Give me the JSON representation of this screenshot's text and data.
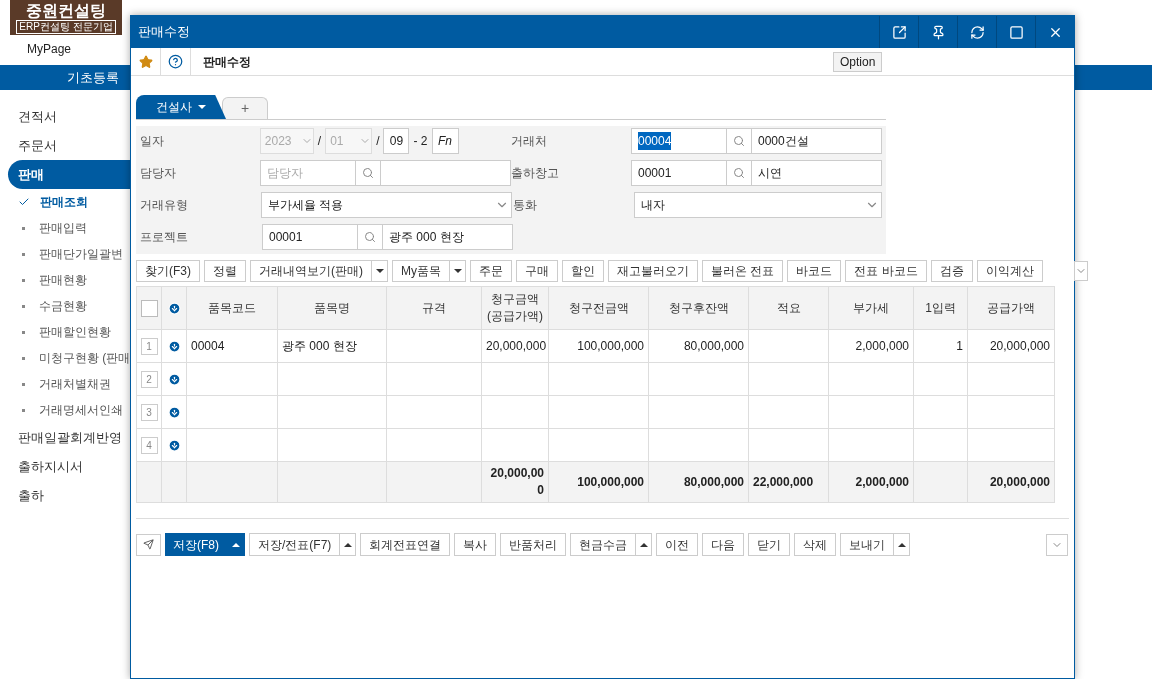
{
  "app": {
    "logo_title": "중원컨설팅",
    "logo_subtitle": "ERP컨설팅 전문기업",
    "mypage": "MyPage",
    "menu_bar": "기초등록"
  },
  "sidebar": [
    {
      "label": "견적서",
      "selected": false
    },
    {
      "label": "주문서",
      "selected": false
    },
    {
      "label": "판매",
      "selected": true,
      "children": [
        {
          "label": "판매조회",
          "selected": true
        },
        {
          "label": "판매입력",
          "selected": false
        },
        {
          "label": "판매단가일괄변",
          "selected": false
        },
        {
          "label": "판매현황",
          "selected": false
        },
        {
          "label": "수금현황",
          "selected": false
        },
        {
          "label": "판매할인현황",
          "selected": false
        },
        {
          "label": "미청구현황 (판매",
          "selected": false
        },
        {
          "label": "거래처별채권",
          "selected": false
        },
        {
          "label": "거래명세서인쇄",
          "selected": false
        }
      ]
    },
    {
      "label": "판매일괄회계반영",
      "selected": false
    },
    {
      "label": "출하지시서",
      "selected": false
    },
    {
      "label": "출하",
      "selected": false
    }
  ],
  "window": {
    "title": "판매수정"
  },
  "header": {
    "favorite": true,
    "title": "판매수정",
    "option": "Option"
  },
  "tabs": [
    {
      "label": "건설사",
      "selected": true
    },
    {
      "label": "+",
      "selected": false
    }
  ],
  "form": {
    "date": {
      "label": "일자",
      "year": "2023",
      "month": "01",
      "day": "09",
      "sep1": "/",
      "sep2": "/",
      "suffix": "- 2",
      "fn": "Fn"
    },
    "customer": {
      "label": "거래처",
      "code": "00004",
      "name": "0000건설",
      "code_selected": true
    },
    "manager": {
      "label": "담당자",
      "placeholder": "담당자"
    },
    "warehouse": {
      "label": "출하창고",
      "code": "00001",
      "name": "시연"
    },
    "trade_type": {
      "label": "거래유형",
      "value": "부가세율 적용"
    },
    "currency": {
      "label": "통화",
      "value": "내자"
    },
    "project": {
      "label": "프로젝트",
      "code": "00001",
      "name": "광주 000 현장"
    }
  },
  "actions": [
    {
      "label": "찾기(F3)",
      "dropdown": false
    },
    {
      "label": "정렬",
      "dropdown": false
    },
    {
      "label": "거래내역보기(판매)",
      "dropdown": true
    },
    {
      "label": "My품목",
      "dropdown": true
    },
    {
      "label": "주문",
      "dropdown": false
    },
    {
      "label": "구매",
      "dropdown": false
    },
    {
      "label": "할인",
      "dropdown": false
    },
    {
      "label": "재고불러오기",
      "dropdown": false
    },
    {
      "label": "불러온 전표",
      "dropdown": false
    },
    {
      "label": "바코드",
      "dropdown": false
    },
    {
      "label": "전표 바코드",
      "dropdown": false
    },
    {
      "label": "검증",
      "dropdown": false
    },
    {
      "label": "이익계산",
      "dropdown": false
    }
  ],
  "table": {
    "select_all_checked": false,
    "columns": [
      {
        "label": "품목코드"
      },
      {
        "label": "품목명"
      },
      {
        "label": "규격"
      },
      {
        "label": "청구금액",
        "sub": "(공급가액)",
        "total": "20,000,000"
      },
      {
        "label": "청구전금액",
        "total": "100,000,000"
      },
      {
        "label": "청구후잔액",
        "total": "80,000,000"
      },
      {
        "label": "적요",
        "total": "22,000,000"
      },
      {
        "label": "부가세",
        "total": "2,000,000"
      },
      {
        "label": "1입력"
      },
      {
        "label": "공급가액",
        "total": "20,000,000"
      }
    ],
    "rows": [
      {
        "no": "1",
        "cells": {
          "0": "00004",
          "1": "광주 000 현장",
          "3": "20,000,000",
          "4": "100,000,000",
          "5": "80,000,000",
          "7": "2,000,000",
          "8": "1",
          "9": "20,000,000"
        }
      },
      {
        "no": "2"
      },
      {
        "no": "3"
      },
      {
        "no": "4"
      }
    ]
  },
  "footer": [
    {
      "label": "저장(F8)",
      "primary": true,
      "dropdown": true
    },
    {
      "label": "저장/전표(F7)",
      "primary": false,
      "dropdown": true
    },
    {
      "label": "회계전표연결",
      "primary": false,
      "dropdown": false
    },
    {
      "label": "복사",
      "primary": false,
      "dropdown": false
    },
    {
      "label": "반품처리",
      "primary": false,
      "dropdown": false
    },
    {
      "label": "현금수금",
      "primary": false,
      "dropdown": true
    },
    {
      "label": "이전",
      "primary": false,
      "dropdown": false
    },
    {
      "label": "다음",
      "primary": false,
      "dropdown": false
    },
    {
      "label": "닫기",
      "primary": false,
      "dropdown": false
    },
    {
      "label": "삭제",
      "primary": false,
      "dropdown": false
    },
    {
      "label": "보내기",
      "primary": false,
      "dropdown": true
    }
  ]
}
